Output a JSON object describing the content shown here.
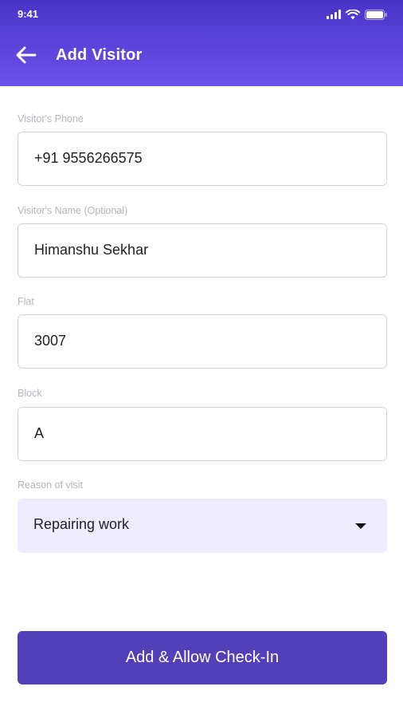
{
  "status_bar": {
    "time": "9:41",
    "icons": [
      "signal-icon",
      "wifi-icon",
      "battery-icon"
    ]
  },
  "app_bar": {
    "back_icon": "arrow-left-icon",
    "title": "Add Visitor"
  },
  "form": {
    "phone": {
      "label": "Visitor's Phone",
      "value": "+91 9556266575"
    },
    "name": {
      "label": "Visitor's Name (Optional)",
      "value": "Himanshu Sekhar"
    },
    "flat": {
      "label": "Flat",
      "value": "3007"
    },
    "block": {
      "label": "Block",
      "value": "A"
    },
    "reason": {
      "label": "Reason of visit",
      "selected": "Repairing work",
      "icon": "caret-down-icon"
    }
  },
  "actions": {
    "submit_label": "Add & Allow Check-In"
  },
  "colors": {
    "header_start": "#4a34c8",
    "header_end": "#6a52ea",
    "primary_button": "#5140b8",
    "select_background": "#eeebff",
    "field_border": "#cdd4e6",
    "label_text": "#b4b4bc"
  }
}
